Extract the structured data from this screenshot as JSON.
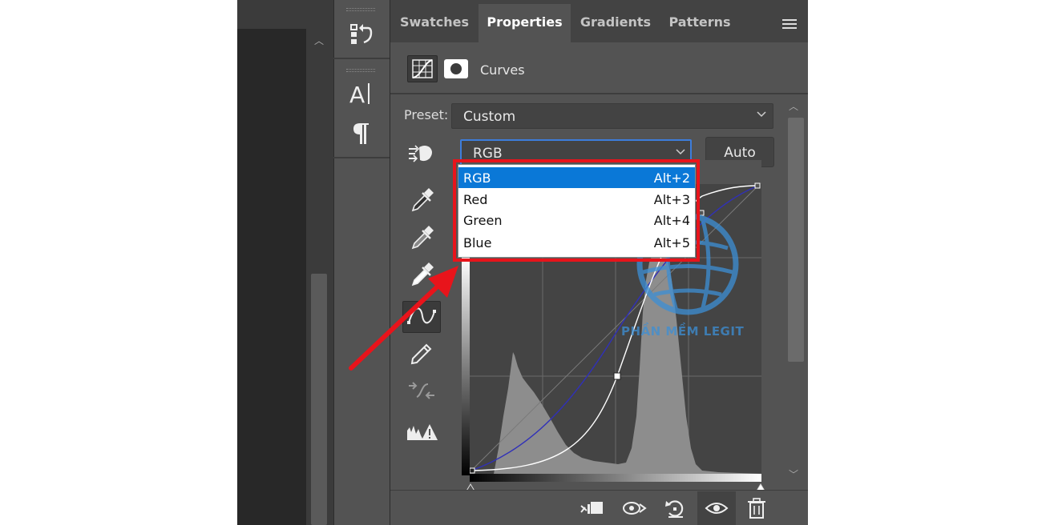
{
  "colors": {
    "panel_bg": "#535353",
    "tab_bar_bg": "#434343",
    "dark_canvas": "#282828",
    "selection_blue": "#0a78d7",
    "focus_border": "#3d7ddb",
    "annotation_red": "#e8141b",
    "curve_blue": "#3030b8"
  },
  "tabs": [
    {
      "label": "Swatches",
      "active": false
    },
    {
      "label": "Properties",
      "active": true
    },
    {
      "label": "Gradients",
      "active": false
    },
    {
      "label": "Patterns",
      "active": false
    }
  ],
  "panel": {
    "title": "Curves",
    "preset_label": "Preset:",
    "preset_value": "Custom",
    "channel_value": "RGB",
    "auto_label": "Auto"
  },
  "dropdown": {
    "items": [
      {
        "label": "RGB",
        "shortcut": "Alt+2",
        "selected": true
      },
      {
        "label": "Red",
        "shortcut": "Alt+3",
        "selected": false
      },
      {
        "label": "Green",
        "shortcut": "Alt+4",
        "selected": false
      },
      {
        "label": "Blue",
        "shortcut": "Alt+5",
        "selected": false
      }
    ]
  },
  "tool_column_icons": [
    "history-icon",
    "character-icon",
    "paragraph-icon"
  ],
  "side_tools": [
    "target-adjust-icon",
    "black-point-eyedropper-icon",
    "gray-point-eyedropper-icon",
    "white-point-eyedropper-icon",
    "curve-points-icon",
    "pencil-icon",
    "smooth-curve-icon",
    "clipping-warning-icon"
  ],
  "bottom_icons": [
    "clip-to-layer-icon",
    "view-previous-icon",
    "reset-icon",
    "visibility-eye-icon",
    "trash-icon"
  ],
  "watermark": "PHẦN MỀM LEGIT"
}
